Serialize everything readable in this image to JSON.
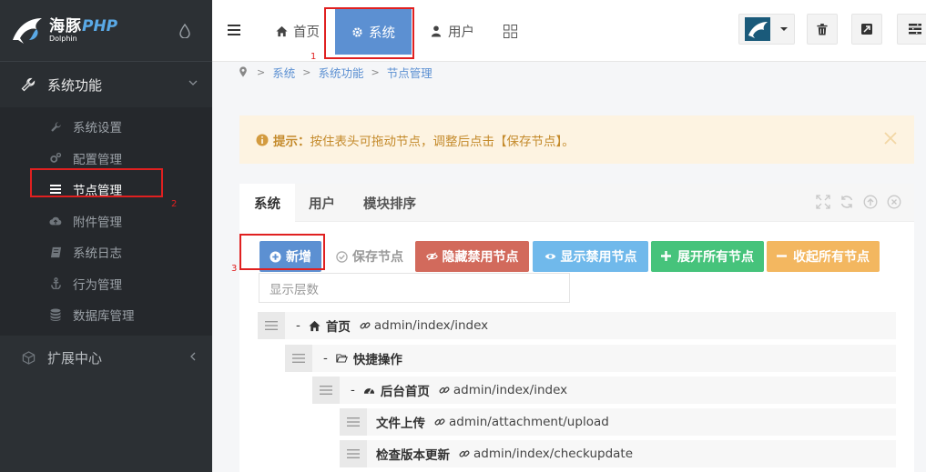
{
  "brand": {
    "name_cn": "海豚",
    "name_php": "PHP",
    "sub": "Dolphin"
  },
  "sidebar": {
    "group_system": "系统功能",
    "items": [
      {
        "label": "系统设置",
        "icon": "wrench-icon"
      },
      {
        "label": "配置管理",
        "icon": "gears-icon"
      },
      {
        "label": "节点管理",
        "icon": "list-icon"
      },
      {
        "label": "附件管理",
        "icon": "cloud-upload-icon"
      },
      {
        "label": "系统日志",
        "icon": "book-icon"
      },
      {
        "label": "行为管理",
        "icon": "anchor-icon"
      },
      {
        "label": "数据库管理",
        "icon": "database-icon"
      }
    ],
    "group_extend": "扩展中心"
  },
  "header": {
    "tabs": [
      {
        "label": "首页",
        "icon": "home-icon"
      },
      {
        "label": "系统",
        "icon": "gear-icon"
      },
      {
        "label": "用户",
        "icon": "user-icon"
      }
    ]
  },
  "breadcrumb": [
    "系统",
    "系统功能",
    "节点管理"
  ],
  "alert": {
    "label": "提示：",
    "text": "按住表头可拖动节点，调整后点击【保存节点】。"
  },
  "panel": {
    "tabs": [
      "系统",
      "用户",
      "模块排序"
    ]
  },
  "toolbar": {
    "add": "新增",
    "save": "保存节点",
    "hide": "隐藏禁用节点",
    "show": "显示禁用节点",
    "expand": "展开所有节点",
    "collapse": "收起所有节点"
  },
  "layer_input": {
    "placeholder": "显示层数"
  },
  "nodes": [
    {
      "dash": "-",
      "icon": "home-icon",
      "title": "首页",
      "url": "admin/index/index"
    },
    {
      "dash": "-",
      "icon": "folder-open-icon",
      "title": "快捷操作",
      "url": ""
    },
    {
      "dash": "-",
      "icon": "dashboard-icon",
      "title": "后台首页",
      "url": "admin/index/index"
    },
    {
      "dash": "",
      "icon": "",
      "title": "文件上传",
      "url": "admin/attachment/upload"
    },
    {
      "dash": "",
      "icon": "",
      "title": "检查版本更新",
      "url": "admin/index/checkupdate"
    }
  ],
  "annotations": [
    "1",
    "2",
    "3"
  ],
  "colors": {
    "sidebar_bg": "#2c3034",
    "primary": "#5c90d2",
    "danger": "#d26a5c",
    "info": "#70b9eb",
    "success": "#46c37b",
    "warning": "#f3b760",
    "annotation": "#e02020"
  }
}
